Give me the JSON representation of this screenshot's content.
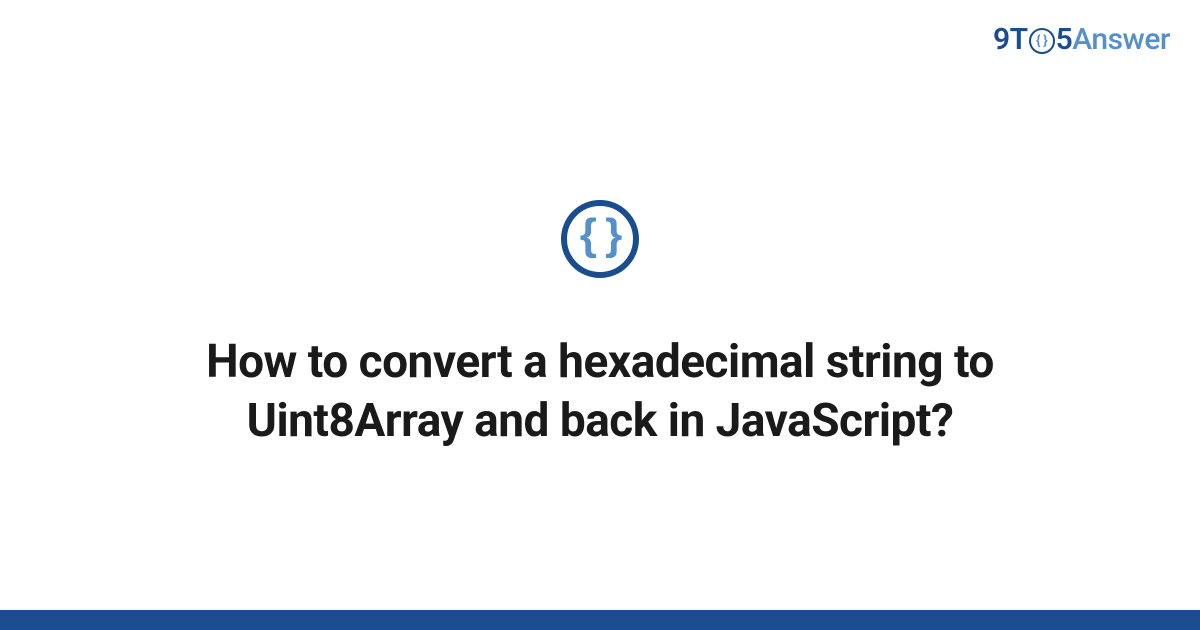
{
  "logo": {
    "part1": "9T",
    "icon_braces": "{ }",
    "part2": "5",
    "part3": "Answer"
  },
  "topic_icon_braces": "{ }",
  "title": "How to convert a hexadecimal string to Uint8Array and back in JavaScript?",
  "colors": {
    "primary": "#1a4d8f",
    "accent": "#5590cc"
  }
}
